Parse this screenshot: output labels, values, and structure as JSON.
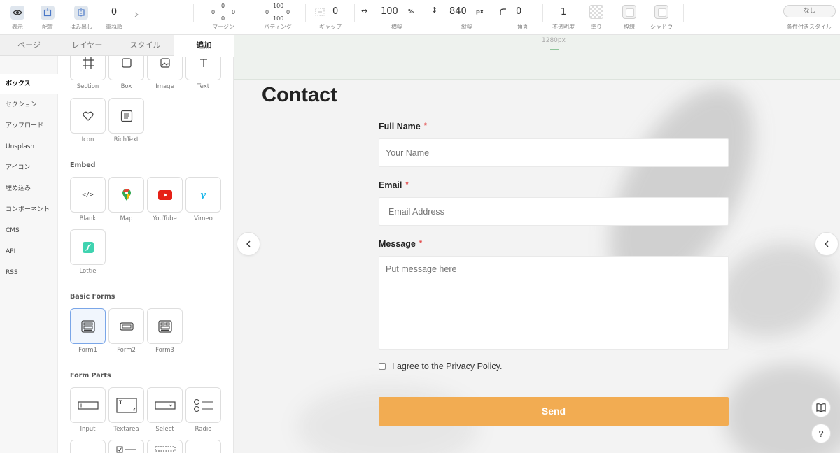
{
  "toolbar": {
    "display_label": "表示",
    "align_label": "配置",
    "overflow_label": "はみ出し",
    "zorder_value": "0",
    "zorder_label": "重ね順",
    "margin": {
      "label": "マージン",
      "top": "0",
      "left": "0",
      "right": "0",
      "bottom": "0"
    },
    "padding": {
      "label": "パディング",
      "top": "100",
      "left": "0",
      "right": "0",
      "bottom": "100"
    },
    "gap": {
      "label": "ギャップ",
      "value": "0"
    },
    "width": {
      "label": "横幅",
      "value": "100",
      "unit": "%"
    },
    "height": {
      "label": "縦幅",
      "value": "840",
      "unit": "px"
    },
    "radius": {
      "label": "角丸",
      "value": "0"
    },
    "opacity": {
      "label": "不透明度",
      "value": "1"
    },
    "fill_label": "塗り",
    "border_label": "枠線",
    "shadow_label": "シャドウ",
    "conditional": {
      "value": "なし",
      "label": "条件付きスタイル"
    }
  },
  "panel": {
    "tabs": [
      {
        "label": "ページ"
      },
      {
        "label": "レイヤー"
      },
      {
        "label": "スタイル"
      },
      {
        "label": "追加"
      }
    ],
    "categories": [
      {
        "label": "ボックス"
      },
      {
        "label": "セクション"
      },
      {
        "label": "アップロード"
      },
      {
        "label": "Unsplash"
      },
      {
        "label": "アイコン"
      },
      {
        "label": "埋め込み"
      },
      {
        "label": "コンポーネント"
      },
      {
        "label": "CMS"
      },
      {
        "label": "API"
      },
      {
        "label": "RSS"
      }
    ],
    "box_items": [
      {
        "label": "Section",
        "icon": "section-icon"
      },
      {
        "label": "Box",
        "icon": "box-icon"
      },
      {
        "label": "Image",
        "icon": "image-icon"
      },
      {
        "label": "Text",
        "icon": "text-icon"
      },
      {
        "label": "Icon",
        "icon": "heart-icon"
      },
      {
        "label": "RichText",
        "icon": "richtext-icon"
      }
    ],
    "embed_title": "Embed",
    "embed_items": [
      {
        "label": "Blank",
        "icon": "code-icon"
      },
      {
        "label": "Map",
        "icon": "map-pin-icon"
      },
      {
        "label": "YouTube",
        "icon": "youtube-icon"
      },
      {
        "label": "Vimeo",
        "icon": "vimeo-icon"
      },
      {
        "label": "Lottie",
        "icon": "lottie-icon"
      }
    ],
    "basic_forms_title": "Basic Forms",
    "form_items": [
      {
        "label": "Form1",
        "icon": "form1-icon"
      },
      {
        "label": "Form2",
        "icon": "form2-icon"
      },
      {
        "label": "Form3",
        "icon": "form3-icon"
      }
    ],
    "form_parts_title": "Form Parts",
    "part_items": [
      {
        "label": "Input",
        "icon": "input-icon"
      },
      {
        "label": "Textarea",
        "icon": "textarea-icon"
      },
      {
        "label": "Select",
        "icon": "select-icon"
      },
      {
        "label": "Radio",
        "icon": "radio-icon"
      }
    ]
  },
  "canvas": {
    "ruler_label": "1280px",
    "title": "Contact",
    "form": {
      "fullname_label": "Full Name",
      "fullname_placeholder": "Your Name",
      "email_label": "Email",
      "email_placeholder": "Email Address",
      "message_label": "Message",
      "message_placeholder": "Put message here",
      "required_mark": "*",
      "agree_text": "I agree to the Privacy Policy.",
      "send_label": "Send"
    },
    "help_label": "?"
  },
  "colors": {
    "accent": "#f2ac52",
    "required": "#e34b4b",
    "selection": "#7aa6e8"
  }
}
